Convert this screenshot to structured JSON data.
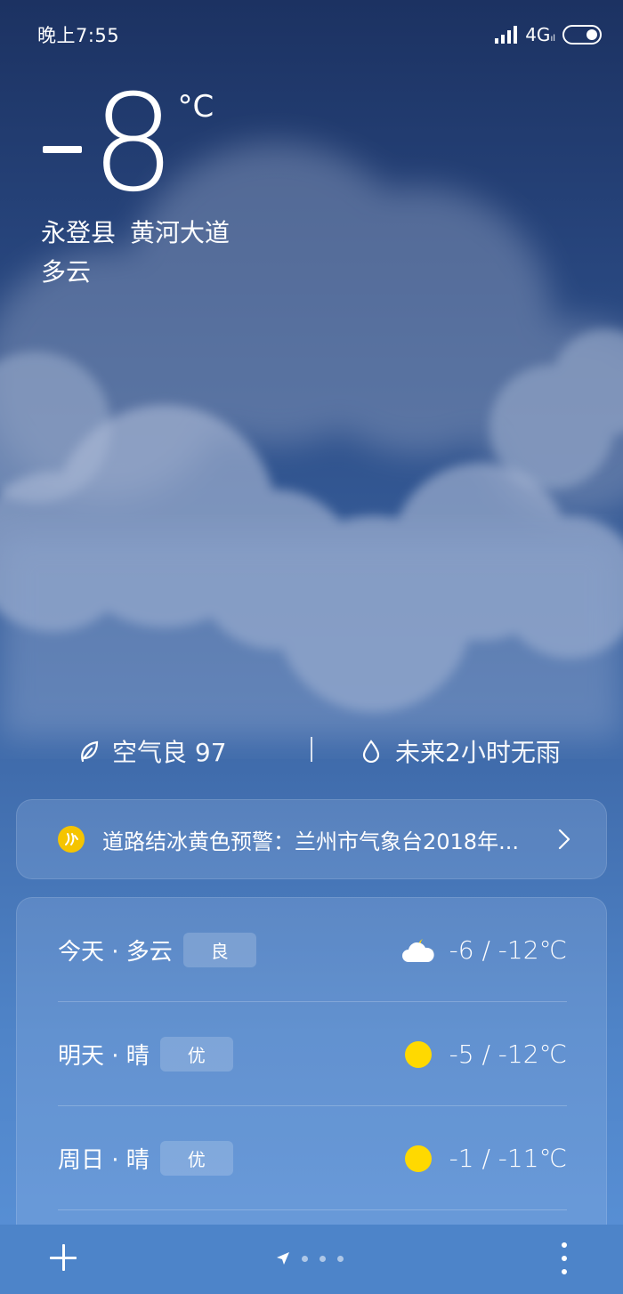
{
  "status_bar": {
    "time": "晚上7:55",
    "network": "4G",
    "network_sub": "ıl"
  },
  "current": {
    "sign": "-",
    "temperature": "8",
    "unit": "°C",
    "district": "永登县",
    "street": "黄河大道",
    "condition": "多云"
  },
  "air": {
    "label": "空气良 97",
    "icon": "leaf-icon"
  },
  "rain": {
    "label": "未来2小时无雨",
    "icon": "raindrop-icon"
  },
  "alert": {
    "text": "道路结冰黄色预警：兰州市气象台2018年...",
    "icon": "road-ice-warning-icon",
    "color": "#f5c400"
  },
  "forecast": [
    {
      "day": "今天 · 多云",
      "aqi": "良",
      "icon": "partly-cloudy-night-icon",
      "range": "-6 / -12℃"
    },
    {
      "day": "明天 · 晴",
      "aqi": "优",
      "icon": "sun-icon",
      "range": "-5 / -12℃"
    },
    {
      "day": "周日 · 晴",
      "aqi": "优",
      "icon": "sun-icon",
      "range": "-1 / -11℃"
    }
  ],
  "colors": {
    "sun": "#ffd900",
    "accent": "#4d84c9"
  }
}
